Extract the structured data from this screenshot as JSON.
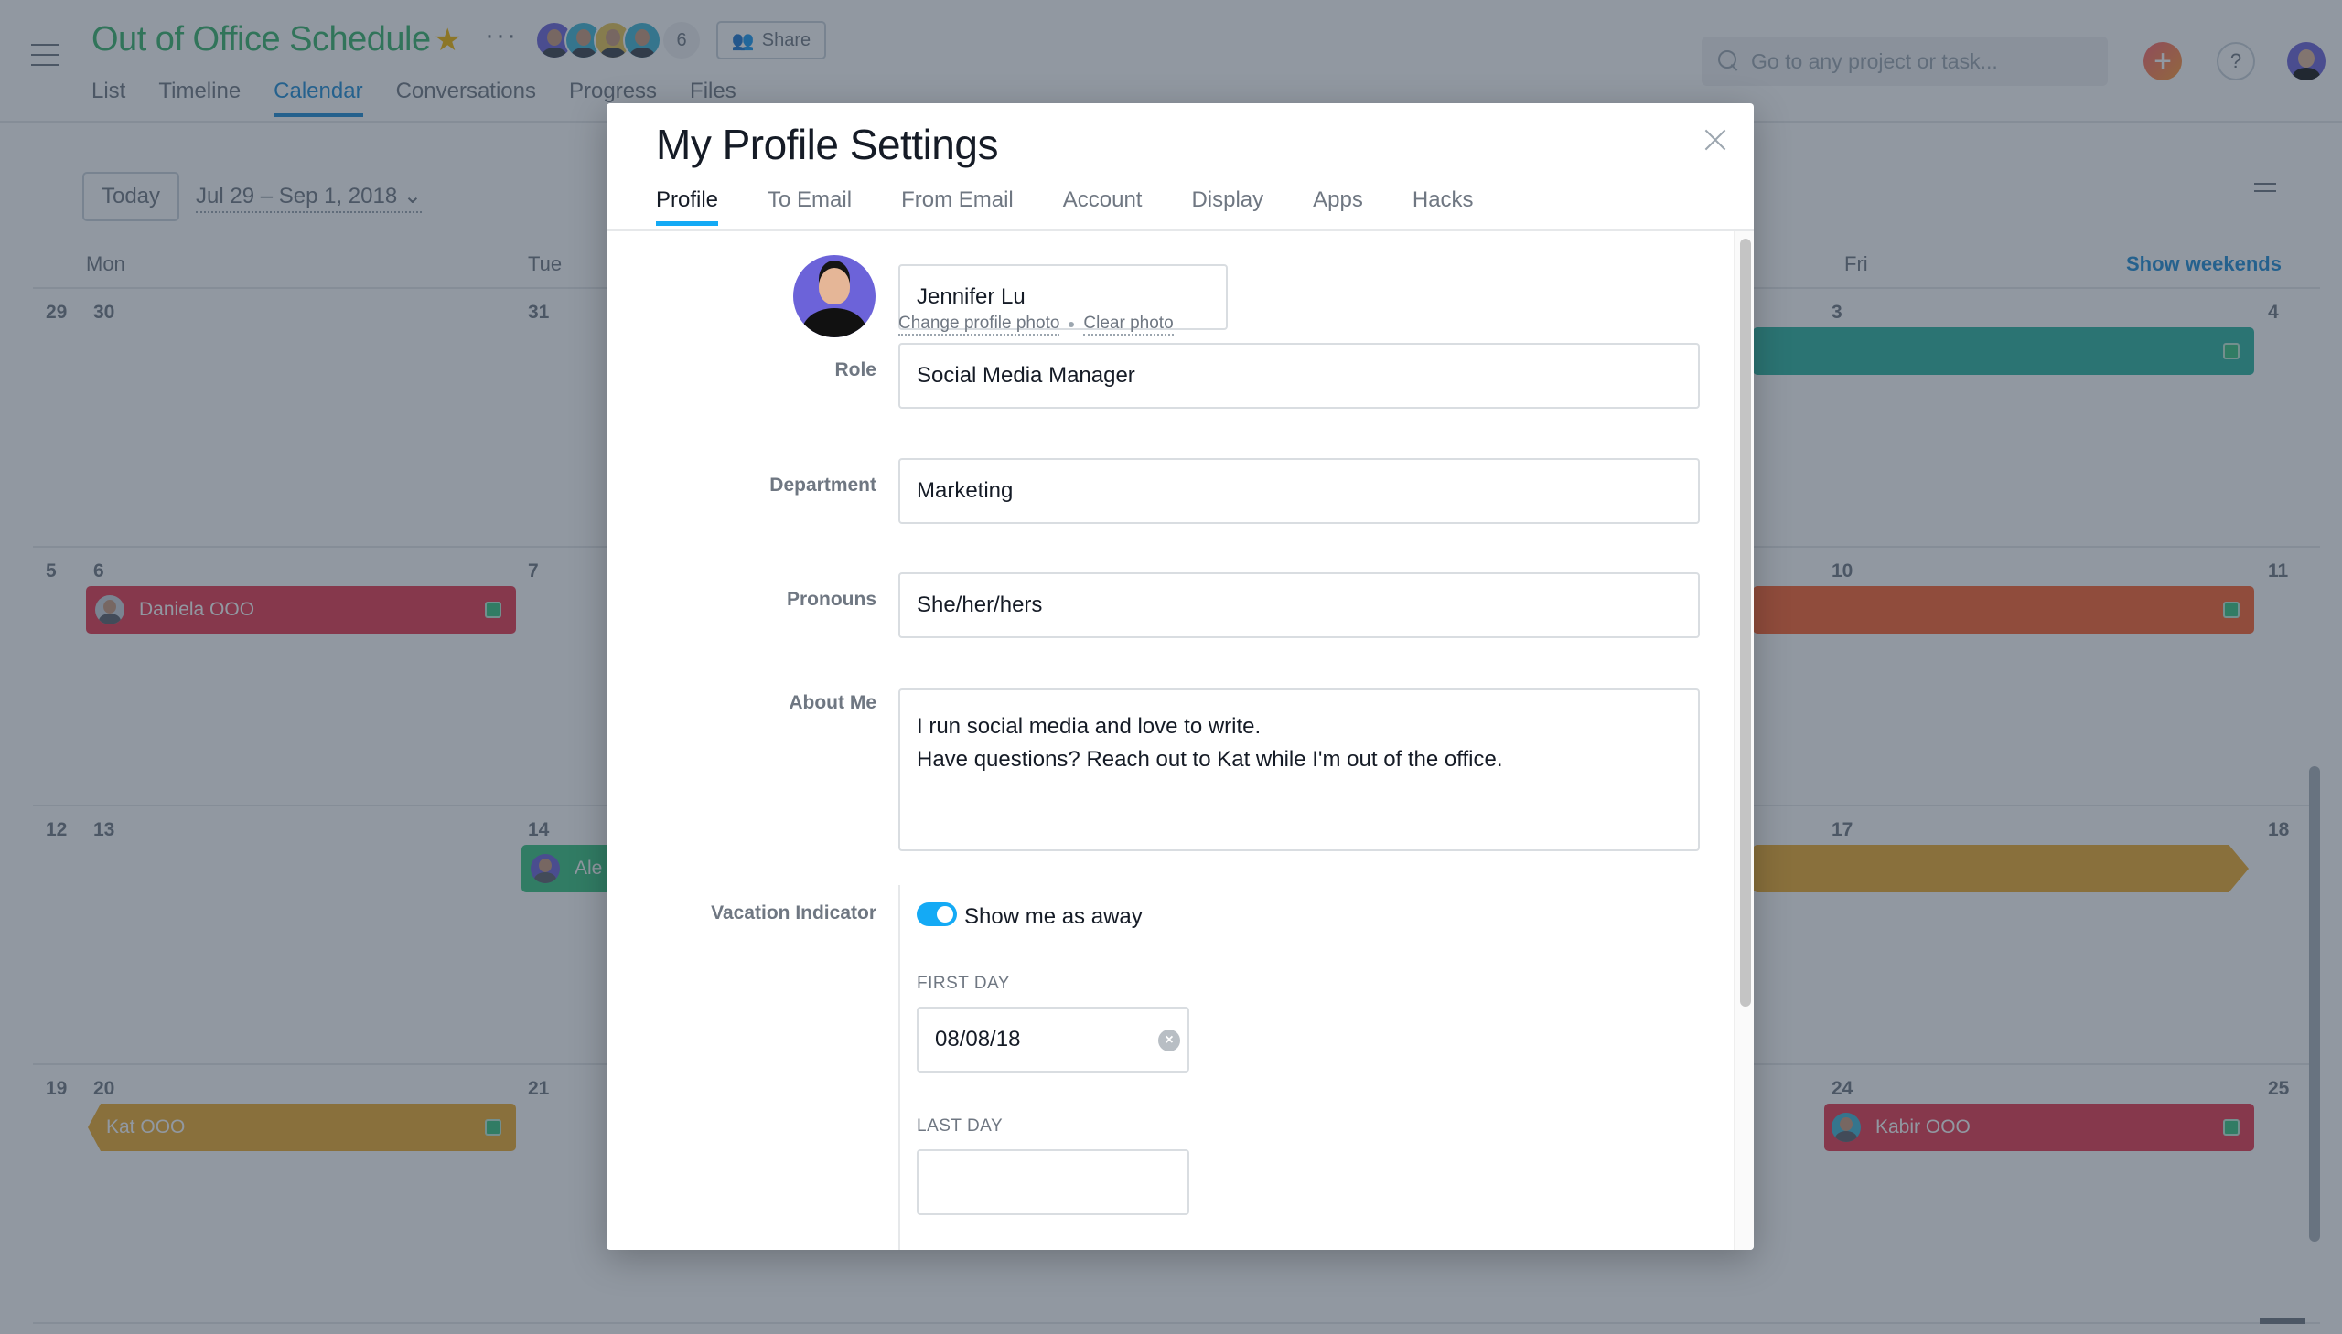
{
  "project": {
    "title": "Out of Office Schedule",
    "member_count": "6",
    "share_label": "Share",
    "tabs": [
      "List",
      "Timeline",
      "Calendar",
      "Conversations",
      "Progress",
      "Files"
    ],
    "active_tab": "Calendar",
    "title_color": "#37b36b",
    "member_avatar_colors": [
      "#6c63d9",
      "#3fb6d6",
      "#e8c552",
      "#3fb6d6"
    ]
  },
  "topbar": {
    "search_placeholder": "Go to any project or task...",
    "add_label": "+",
    "help_label": "?"
  },
  "calendar": {
    "today_label": "Today",
    "date_range": "Jul 29 – Sep 1, 2018",
    "show_weekends": "Show weekends",
    "weekday_headers": [
      "Mon",
      "Tue",
      "Fri"
    ],
    "weeks": [
      {
        "week_num": "29",
        "days": [
          "30",
          "31",
          "3",
          "4"
        ]
      },
      {
        "week_num": "5",
        "days": [
          "6",
          "7",
          "10",
          "11"
        ]
      },
      {
        "week_num": "12",
        "days": [
          "13",
          "14",
          "17",
          "18"
        ]
      },
      {
        "week_num": "19",
        "days": [
          "20",
          "21",
          "24",
          "25"
        ]
      }
    ],
    "events": [
      {
        "label": "",
        "color": "#2bb3a0"
      },
      {
        "label": "Daniela OOO",
        "color": "#e8384f"
      },
      {
        "label": "",
        "color": "#fd612c"
      },
      {
        "label": "Ale",
        "color": "#37c580"
      },
      {
        "label": "",
        "color": "#eeac2c"
      },
      {
        "label": "Kat OOO",
        "color": "#eeac2c"
      },
      {
        "label": "Kabir OOO",
        "color": "#e8384f"
      }
    ]
  },
  "modal": {
    "title": "My Profile Settings",
    "tabs": [
      "Profile",
      "To Email",
      "From Email",
      "Account",
      "Display",
      "Apps",
      "Hacks"
    ],
    "active_tab": "Profile",
    "name_value": "Jennifer Lu",
    "change_photo": "Change profile photo",
    "clear_photo": "Clear photo",
    "fields": {
      "role": {
        "label": "Role",
        "value": "Social Media Manager"
      },
      "department": {
        "label": "Department",
        "value": "Marketing"
      },
      "pronouns": {
        "label": "Pronouns",
        "value": "She/her/hers"
      },
      "about": {
        "label": "About Me",
        "value": "I run social media and love to write.\nHave questions? Reach out to Kat while I'm out of the office."
      }
    },
    "vacation": {
      "label": "Vacation Indicator",
      "toggle_label": "Show me as away",
      "toggle_on": true,
      "first_day_label": "FIRST DAY",
      "first_day_value": "08/08/18",
      "last_day_label": "LAST DAY",
      "last_day_value": ""
    },
    "accent_color": "#14aaf5"
  }
}
